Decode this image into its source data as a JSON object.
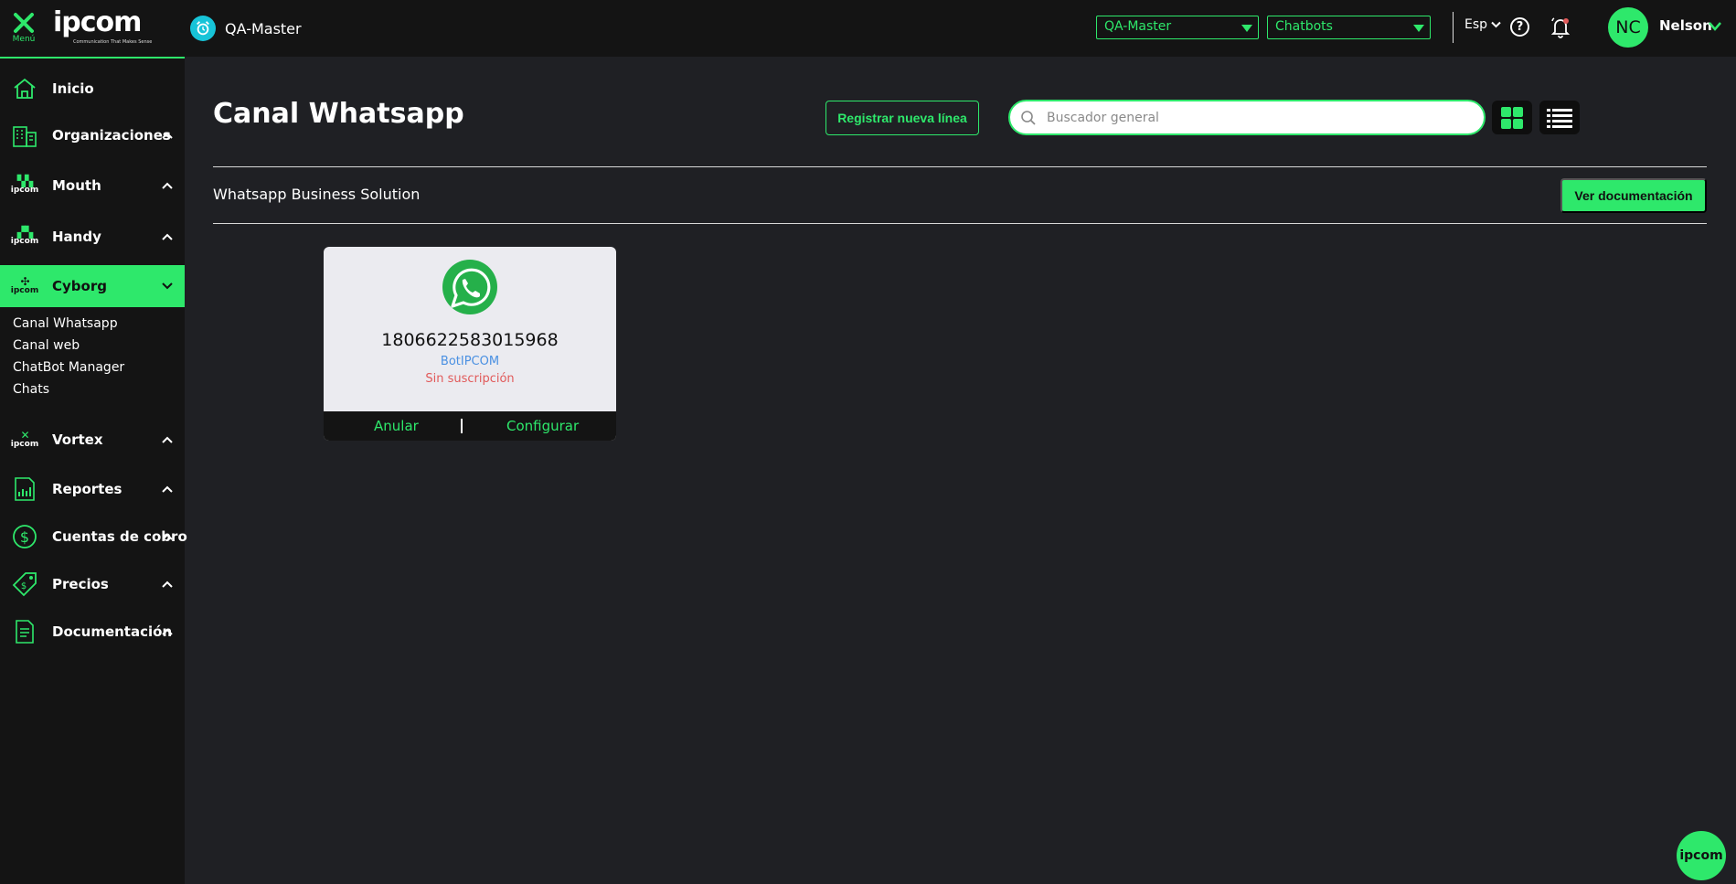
{
  "header": {
    "menu_label": "Menú",
    "logo_text": "ipcom",
    "logo_tagline": "Communication That Makes Sense",
    "org_name": "QA-Master",
    "org_select": "QA-Master",
    "module_select": "Chatbots",
    "language": "Esp",
    "help_symbol": "?",
    "user_initials": "NC",
    "user_name": "Nelson"
  },
  "sidebar": {
    "items": [
      {
        "label": "Inicio",
        "icon": "home-icon"
      },
      {
        "label": "Organizaciones",
        "icon": "building-icon"
      },
      {
        "label": "Mouth",
        "icon": "mouth-icon"
      },
      {
        "label": "Handy",
        "icon": "handy-icon"
      },
      {
        "label": "Cyborg",
        "icon": "cyborg-icon"
      },
      {
        "label": "Vortex",
        "icon": "vortex-icon"
      },
      {
        "label": "Reportes",
        "icon": "report-icon"
      },
      {
        "label": "Cuentas de cobro",
        "icon": "dollar-icon"
      },
      {
        "label": "Precios",
        "icon": "tag-icon"
      },
      {
        "label": "Documentación",
        "icon": "document-icon"
      }
    ],
    "cyborg_subitems": [
      "Canal Whatsapp",
      "Canal web",
      "ChatBot Manager",
      "Chats"
    ],
    "ipcom_badge": "ipcom"
  },
  "main": {
    "title": "Canal Whatsapp",
    "register_button": "Registrar nueva línea",
    "search_placeholder": "Buscador general",
    "section_title": "Whatsapp Business Solution",
    "docs_button": "Ver documentación",
    "card": {
      "number": "1806622583015968",
      "bot_name": "BotIPCOM",
      "status": "Sin suscripción",
      "cancel_label": "Anular",
      "configure_label": "Configurar"
    }
  },
  "fab_label": "ipcom",
  "colors": {
    "accent": "#2ee86b",
    "background": "#1f2024",
    "sidebar": "#141414",
    "status_error": "#e15a5a",
    "link_blue": "#4a90e2"
  }
}
